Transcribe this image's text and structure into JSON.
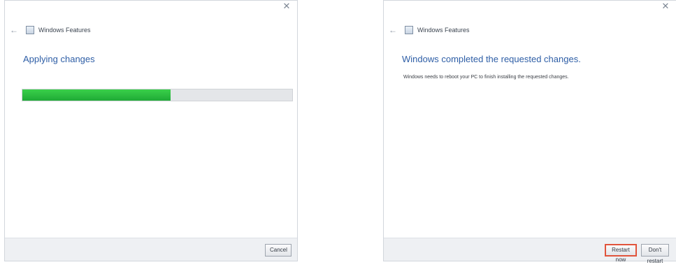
{
  "left_dialog": {
    "title": "Windows Features",
    "heading": "Applying changes",
    "progress": 0.55,
    "cancel_label": "Cancel"
  },
  "right_dialog": {
    "title": "Windows Features",
    "heading": "Windows completed the requested changes.",
    "message": "Windows needs to reboot your PC to finish installing the requested changes.",
    "restart_now_label": "Restart now",
    "dont_restart_label": "Don't restart"
  },
  "colors": {
    "progress_fill": "#27b83c",
    "heading_blue": "#2e5ea6",
    "highlight_outline": "#e1543c"
  }
}
